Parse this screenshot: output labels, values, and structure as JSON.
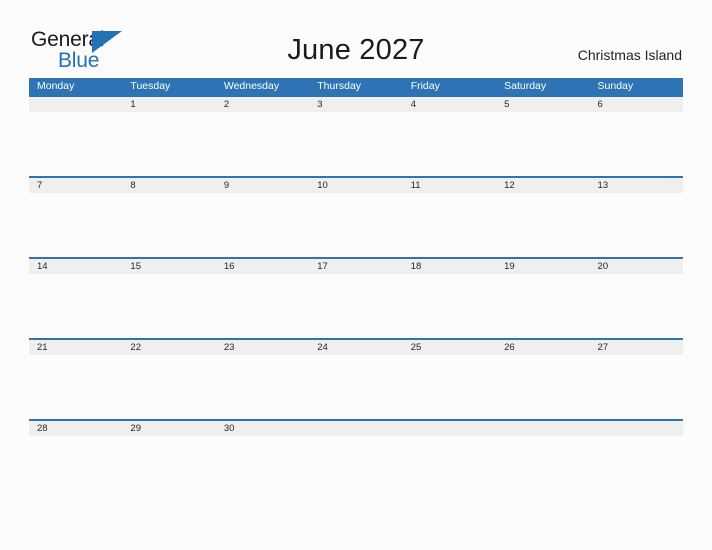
{
  "brand": {
    "name_part1": "General",
    "name_part2": "Blue",
    "triangle_color": "#2272b8",
    "text_color": "#1b1b1b"
  },
  "header": {
    "title": "June 2027",
    "location": "Christmas Island"
  },
  "calendar": {
    "accent_color": "#2e74b5",
    "date_band_color": "#efefef",
    "weekday_headers": [
      "Monday",
      "Tuesday",
      "Wednesday",
      "Thursday",
      "Friday",
      "Saturday",
      "Sunday"
    ],
    "weeks": [
      {
        "days": [
          "",
          "1",
          "2",
          "3",
          "4",
          "5",
          "6"
        ]
      },
      {
        "days": [
          "7",
          "8",
          "9",
          "10",
          "11",
          "12",
          "13"
        ]
      },
      {
        "days": [
          "14",
          "15",
          "16",
          "17",
          "18",
          "19",
          "20"
        ]
      },
      {
        "days": [
          "21",
          "22",
          "23",
          "24",
          "25",
          "26",
          "27"
        ]
      },
      {
        "days": [
          "28",
          "29",
          "30",
          "",
          "",
          "",
          ""
        ]
      }
    ]
  }
}
